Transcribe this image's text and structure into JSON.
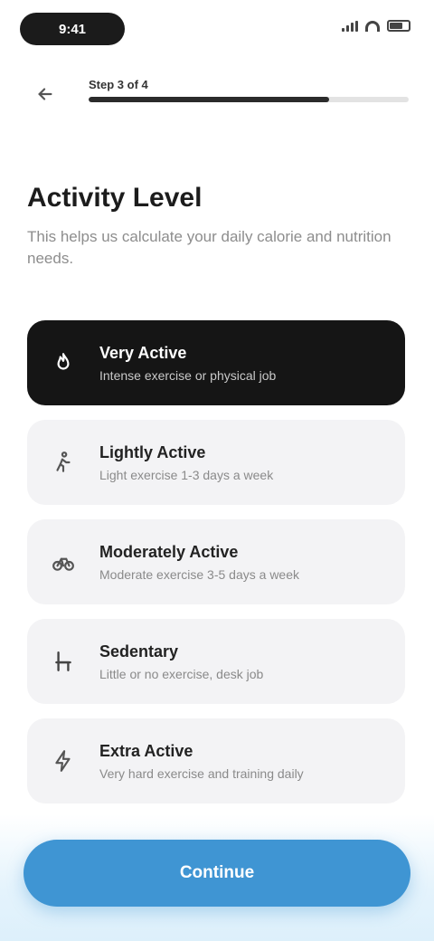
{
  "status_bar": {
    "time": "9:41"
  },
  "header": {
    "step_label": "Step 3 of 4",
    "progress": 0.75
  },
  "heading": {
    "title": "Activity Level",
    "subtitle": "This helps us calculate your daily calorie and nutrition needs."
  },
  "options": [
    {
      "title": "Very Active",
      "description": "Intense exercise or physical job",
      "icon": "flame-icon",
      "selected": true
    },
    {
      "title": "Lightly Active",
      "description": "Light exercise 1-3 days a week",
      "icon": "walk-icon",
      "selected": false
    },
    {
      "title": "Moderately Active",
      "description": "Moderate exercise 3-5 days a week",
      "icon": "bike-icon",
      "selected": false
    },
    {
      "title": "Sedentary",
      "description": "Little or no exercise, desk job",
      "icon": "chair-icon",
      "selected": false
    },
    {
      "title": "Extra Active",
      "description": "Very hard exercise and training daily",
      "icon": "bolt-icon",
      "selected": false
    }
  ],
  "footer": {
    "continue_label": "Continue"
  },
  "colors": {
    "accent": "#3f95d3",
    "selected_bg": "#151515",
    "option_bg": "#f3f3f5"
  }
}
